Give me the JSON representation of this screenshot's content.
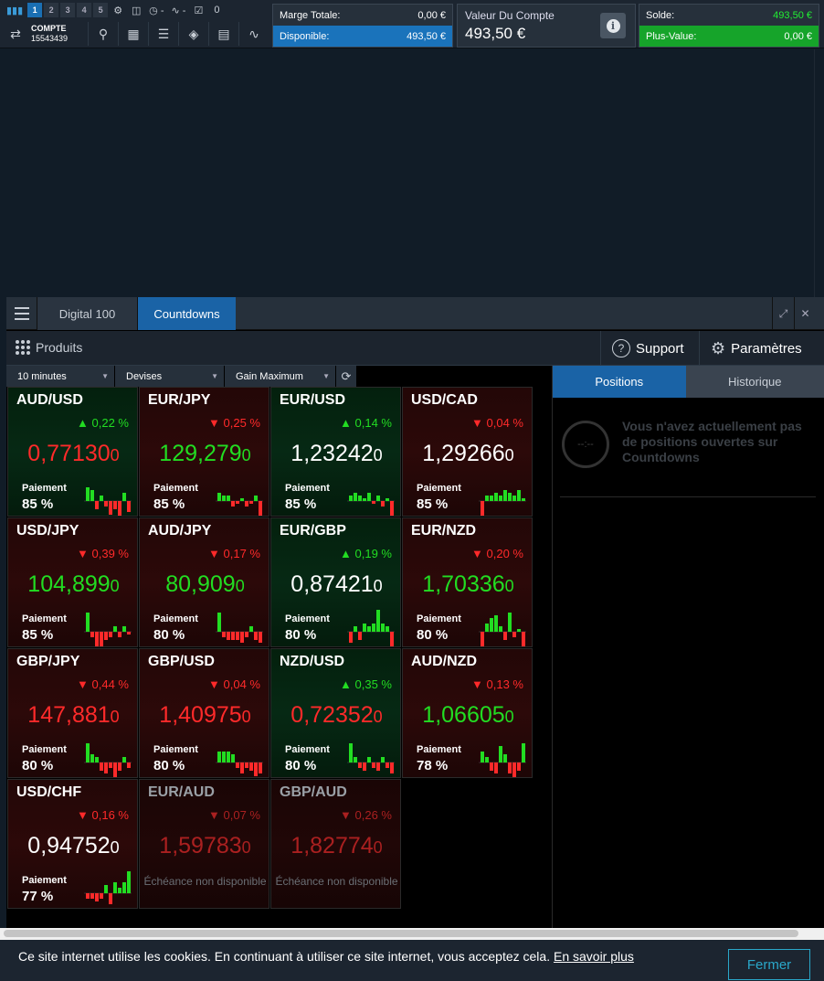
{
  "toolbar": {
    "workspaces": [
      "1",
      "2",
      "3",
      "4",
      "5"
    ],
    "active_workspace": "1",
    "checkbox_count": "0",
    "account_label": "COMPTE",
    "account_number": "15543439"
  },
  "marge": {
    "label": "Marge Totale:",
    "value": "0,00 €",
    "dispo_label": "Disponible:",
    "dispo_value": "493,50 €"
  },
  "valeur": {
    "label": "Valeur Du Compte",
    "value": "493,50 €"
  },
  "solde": {
    "label": "Solde:",
    "value": "493,50 €",
    "pv_label": "Plus-Value:",
    "pv_value": "0,00 €"
  },
  "widget": {
    "tabs": [
      "Digital 100",
      "Countdowns"
    ],
    "active_tab": "Countdowns",
    "produits_label": "Produits",
    "support_label": "Support",
    "parametres_label": "Paramètres",
    "filters": [
      {
        "label": "10 minutes"
      },
      {
        "label": "Devises"
      },
      {
        "label": "Gain Maximum"
      }
    ],
    "right_tabs": [
      "Positions",
      "Historique"
    ],
    "empty_message": "Vous n'avez actuellement pas de positions ouvertes sur Countdowns",
    "empty_clock": "--:--"
  },
  "colors": {
    "up": "#22dd22",
    "down": "#ff2a2a",
    "accent": "#1a63a6"
  },
  "payment_label": "Paiement",
  "unavailable_label": "Échéance non disponible",
  "tiles": [
    {
      "pair": "AUD/USD",
      "dir": "up",
      "change": "0,22 %",
      "price": "0,77130",
      "tail": "0",
      "price_color": "down",
      "payment": "85 %",
      "spark": [
        5,
        4,
        -3,
        2,
        -2,
        -5,
        -3,
        -6,
        3,
        -4
      ]
    },
    {
      "pair": "EUR/JPY",
      "dir": "down",
      "change": "0,25 %",
      "price": "129,279",
      "tail": "0",
      "price_color": "up",
      "payment": "85 %",
      "spark": [
        3,
        2,
        2,
        -2,
        -1,
        1,
        -2,
        -1,
        2,
        -6
      ]
    },
    {
      "pair": "EUR/USD",
      "dir": "up",
      "change": "0,14 %",
      "price": "1,23242",
      "tail": "0",
      "price_color": "neu",
      "payment": "85 %",
      "spark": [
        2,
        3,
        2,
        1,
        3,
        -1,
        2,
        -2,
        1,
        -6
      ]
    },
    {
      "pair": "USD/CAD",
      "dir": "down",
      "change": "0,04 %",
      "price": "1,29266",
      "tail": "0",
      "price_color": "neu",
      "payment": "85 %",
      "spark": [
        -6,
        2,
        2,
        3,
        2,
        4,
        3,
        2,
        4,
        1
      ]
    },
    {
      "pair": "USD/JPY",
      "dir": "down",
      "change": "0,39 %",
      "price": "104,899",
      "tail": "0",
      "price_color": "up",
      "payment": "85 %",
      "spark": [
        7,
        -2,
        -6,
        -6,
        -3,
        -2,
        2,
        -2,
        2,
        -1
      ]
    },
    {
      "pair": "AUD/JPY",
      "dir": "down",
      "change": "0,17 %",
      "price": "80,909",
      "tail": "0",
      "price_color": "up",
      "payment": "80 %",
      "spark": [
        7,
        -2,
        -3,
        -3,
        -3,
        -4,
        -2,
        2,
        -3,
        -4
      ]
    },
    {
      "pair": "EUR/GBP",
      "dir": "up",
      "change": "0,19 %",
      "price": "0,87421",
      "tail": "0",
      "price_color": "neu",
      "payment": "80 %",
      "spark": [
        -4,
        2,
        -3,
        3,
        2,
        3,
        8,
        3,
        2,
        -6
      ]
    },
    {
      "pair": "EUR/NZD",
      "dir": "down",
      "change": "0,20 %",
      "price": "1,70336",
      "tail": "0",
      "price_color": "up",
      "payment": "80 %",
      "spark": [
        -6,
        3,
        5,
        6,
        2,
        -3,
        7,
        -2,
        1,
        -6
      ]
    },
    {
      "pair": "GBP/JPY",
      "dir": "down",
      "change": "0,44 %",
      "price": "147,881",
      "tail": "0",
      "price_color": "down",
      "payment": "80 %",
      "spark": [
        7,
        3,
        2,
        -3,
        -4,
        -2,
        -6,
        -3,
        2,
        -2
      ]
    },
    {
      "pair": "GBP/USD",
      "dir": "down",
      "change": "0,04 %",
      "price": "1,40975",
      "tail": "0",
      "price_color": "down",
      "payment": "80 %",
      "spark": [
        4,
        4,
        4,
        3,
        -2,
        -4,
        -2,
        -3,
        -5,
        -4
      ]
    },
    {
      "pair": "NZD/USD",
      "dir": "up",
      "change": "0,35 %",
      "price": "0,72352",
      "tail": "0",
      "price_color": "down",
      "payment": "80 %",
      "spark": [
        7,
        2,
        -2,
        -3,
        2,
        -2,
        -3,
        2,
        -2,
        -4
      ]
    },
    {
      "pair": "AUD/NZD",
      "dir": "down",
      "change": "0,13 %",
      "price": "1,06605",
      "tail": "0",
      "price_color": "up",
      "payment": "78 %",
      "spark": [
        4,
        2,
        -3,
        -4,
        6,
        3,
        -4,
        -7,
        -3,
        7
      ]
    },
    {
      "pair": "USD/CHF",
      "dir": "down",
      "change": "0,16 %",
      "price": "0,94752",
      "tail": "0",
      "price_color": "neu",
      "payment": "77 %",
      "spark": [
        -2,
        -2,
        -3,
        -2,
        3,
        -4,
        4,
        2,
        4,
        8
      ]
    },
    {
      "pair": "EUR/AUD",
      "dir": "down",
      "change": "0,07 %",
      "price": "1,59783",
      "tail": "0",
      "price_color": "dis",
      "payment": "",
      "spark": [],
      "unavailable": true
    },
    {
      "pair": "GBP/AUD",
      "dir": "down",
      "change": "0,26 %",
      "price": "1,82774",
      "tail": "0",
      "price_color": "dis",
      "payment": "",
      "spark": [],
      "unavailable": true
    }
  ],
  "cookie": {
    "text": "Ce site internet utilise les cookies. En continuant à utiliser ce site internet, vous acceptez cela.",
    "link": "En savoir plus",
    "button": "Fermer"
  }
}
